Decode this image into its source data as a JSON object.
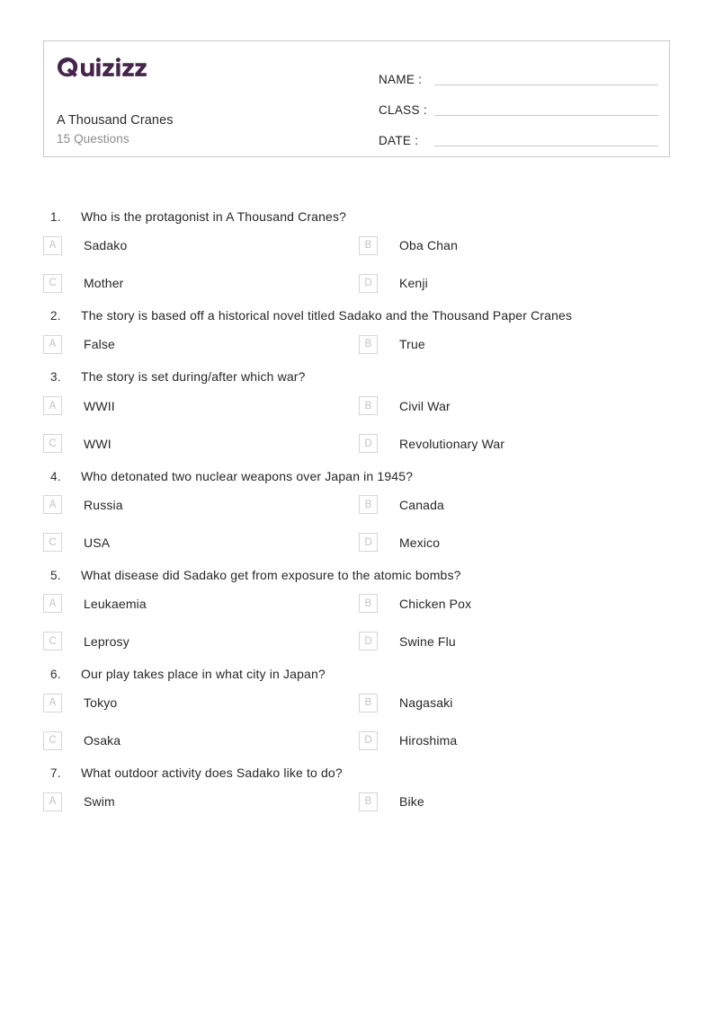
{
  "brand": {
    "logo_text": "Quizizz",
    "logo_color": "#46244c"
  },
  "header": {
    "title": "A Thousand Cranes",
    "subtitle": "15 Questions",
    "fields": [
      {
        "label": "NAME :",
        "value": ""
      },
      {
        "label": "CLASS :",
        "value": ""
      },
      {
        "label": "DATE  :",
        "value": ""
      }
    ]
  },
  "questions": [
    {
      "number": "1.",
      "text": "Who is the protagonist in A Thousand Cranes?",
      "options": [
        {
          "letter": "A",
          "text": "Sadako"
        },
        {
          "letter": "B",
          "text": "Oba Chan"
        },
        {
          "letter": "C",
          "text": "Mother"
        },
        {
          "letter": "D",
          "text": "Kenji"
        }
      ]
    },
    {
      "number": "2.",
      "text": "The story is based off a historical novel titled Sadako and the Thousand Paper Cranes",
      "options": [
        {
          "letter": "A",
          "text": "False"
        },
        {
          "letter": "B",
          "text": "True"
        }
      ]
    },
    {
      "number": "3.",
      "text": "The story is set during/after which war?",
      "options": [
        {
          "letter": "A",
          "text": "WWII"
        },
        {
          "letter": "B",
          "text": "Civil War"
        },
        {
          "letter": "C",
          "text": "WWI"
        },
        {
          "letter": "D",
          "text": "Revolutionary War"
        }
      ]
    },
    {
      "number": "4.",
      "text": "Who detonated two nuclear weapons over Japan in 1945?",
      "options": [
        {
          "letter": "A",
          "text": "Russia"
        },
        {
          "letter": "B",
          "text": "Canada"
        },
        {
          "letter": "C",
          "text": "USA"
        },
        {
          "letter": "D",
          "text": "Mexico"
        }
      ]
    },
    {
      "number": "5.",
      "text": "What disease did Sadako get from exposure to the atomic bombs?",
      "options": [
        {
          "letter": "A",
          "text": "Leukaemia"
        },
        {
          "letter": "B",
          "text": "Chicken Pox"
        },
        {
          "letter": "C",
          "text": "Leprosy"
        },
        {
          "letter": "D",
          "text": "Swine Flu"
        }
      ]
    },
    {
      "number": "6.",
      "text": "Our play takes place in what city in Japan?",
      "options": [
        {
          "letter": "A",
          "text": "Tokyo"
        },
        {
          "letter": "B",
          "text": "Nagasaki"
        },
        {
          "letter": "C",
          "text": "Osaka"
        },
        {
          "letter": "D",
          "text": "Hiroshima"
        }
      ]
    },
    {
      "number": "7.",
      "text": "What outdoor activity does Sadako like to do?",
      "options": [
        {
          "letter": "A",
          "text": "Swim"
        },
        {
          "letter": "B",
          "text": "Bike"
        }
      ]
    }
  ]
}
